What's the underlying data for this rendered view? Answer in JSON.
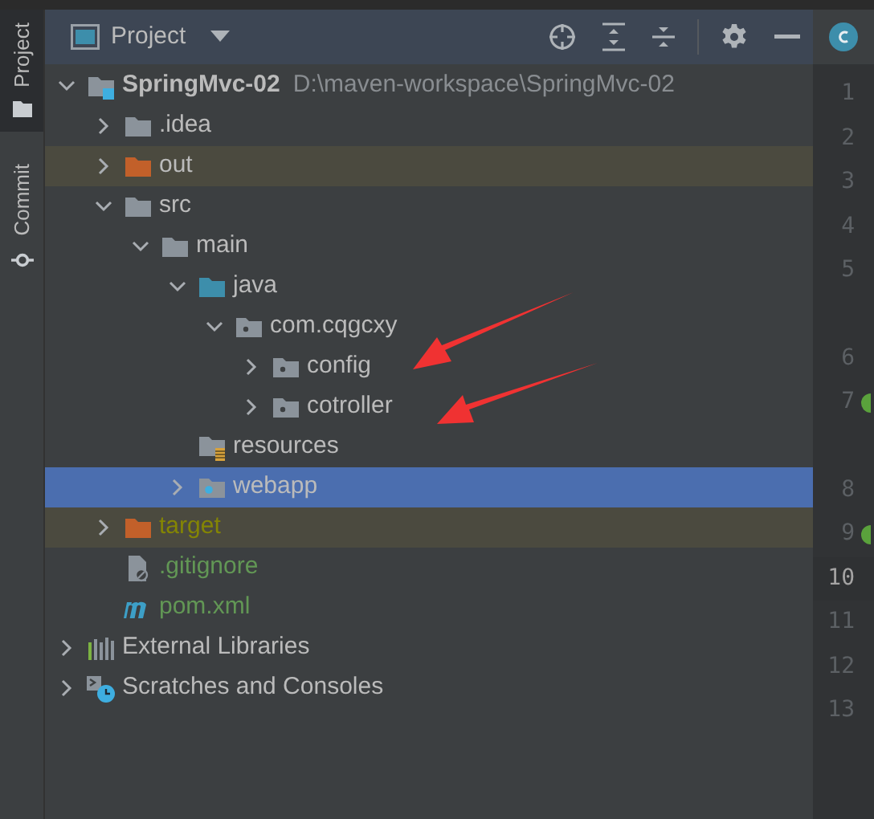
{
  "side_tabs": [
    {
      "label": "Project",
      "selected": true
    },
    {
      "label": "Commit",
      "selected": false
    }
  ],
  "panel": {
    "title": "Project"
  },
  "tree": [
    {
      "label": "SpringMvc-02",
      "location": "D:\\maven-workspace\\SpringMvc-02",
      "kind": "module",
      "expanded": true,
      "selected": false,
      "excluded": false,
      "ignored": false,
      "added": false,
      "children": [
        {
          "label": ".idea",
          "kind": "folder",
          "expanded": false,
          "selected": false,
          "excluded": false,
          "ignored": false,
          "added": false
        },
        {
          "label": "out",
          "kind": "excluded-folder",
          "expanded": false,
          "selected": false,
          "excluded": true,
          "ignored": false,
          "added": false
        },
        {
          "label": "src",
          "kind": "folder",
          "expanded": true,
          "selected": false,
          "excluded": false,
          "ignored": false,
          "added": false,
          "children": [
            {
              "label": "main",
              "kind": "folder",
              "expanded": true,
              "selected": false,
              "excluded": false,
              "ignored": false,
              "added": false,
              "children": [
                {
                  "label": "java",
                  "kind": "source-folder",
                  "expanded": true,
                  "selected": false,
                  "excluded": false,
                  "ignored": false,
                  "added": false,
                  "children": [
                    {
                      "label": "com.cqgcxy",
                      "kind": "package",
                      "expanded": true,
                      "selected": false,
                      "excluded": false,
                      "ignored": false,
                      "added": false,
                      "children": [
                        {
                          "label": "config",
                          "kind": "package",
                          "expanded": false,
                          "selected": false,
                          "excluded": false,
                          "ignored": false,
                          "added": false
                        },
                        {
                          "label": "cotroller",
                          "kind": "package",
                          "expanded": false,
                          "selected": false,
                          "excluded": false,
                          "ignored": false,
                          "added": false
                        }
                      ]
                    }
                  ]
                },
                {
                  "label": "resources",
                  "kind": "resources",
                  "selected": false,
                  "excluded": false,
                  "ignored": false,
                  "added": false
                },
                {
                  "label": "webapp",
                  "kind": "web",
                  "expanded": false,
                  "selected": true,
                  "excluded": false,
                  "ignored": false,
                  "added": false
                }
              ]
            }
          ]
        },
        {
          "label": "target",
          "kind": "excluded-folder",
          "expanded": false,
          "selected": false,
          "excluded": true,
          "ignored": true,
          "added": false
        },
        {
          "label": ".gitignore",
          "kind": "gitignore",
          "selected": false,
          "excluded": false,
          "ignored": false,
          "added": true
        },
        {
          "label": "pom.xml",
          "kind": "maven",
          "selected": false,
          "excluded": false,
          "ignored": false,
          "added": true
        }
      ]
    },
    {
      "label": "External Libraries",
      "kind": "libraries",
      "expanded": false,
      "selected": false,
      "excluded": false,
      "ignored": false,
      "added": false
    },
    {
      "label": "Scratches and Consoles",
      "kind": "scratches",
      "expanded": false,
      "selected": false,
      "excluded": false,
      "ignored": false,
      "added": false
    }
  ],
  "gutter": [
    {
      "number": "1",
      "current": false,
      "marker": false
    },
    {
      "number": "2",
      "current": false,
      "marker": false
    },
    {
      "number": "3",
      "current": false,
      "marker": false
    },
    {
      "number": "4",
      "current": false,
      "marker": false
    },
    {
      "number": "5",
      "current": false,
      "marker": false
    },
    {
      "number": "6",
      "current": false,
      "marker": false
    },
    {
      "number": "7",
      "current": false,
      "marker": true
    },
    {
      "number": "8",
      "current": false,
      "marker": false
    },
    {
      "number": "9",
      "current": false,
      "marker": true
    },
    {
      "number": "10",
      "current": true,
      "marker": false
    },
    {
      "number": "11",
      "current": false,
      "marker": false
    },
    {
      "number": "12",
      "current": false,
      "marker": false
    },
    {
      "number": "13",
      "current": false,
      "marker": false
    }
  ]
}
